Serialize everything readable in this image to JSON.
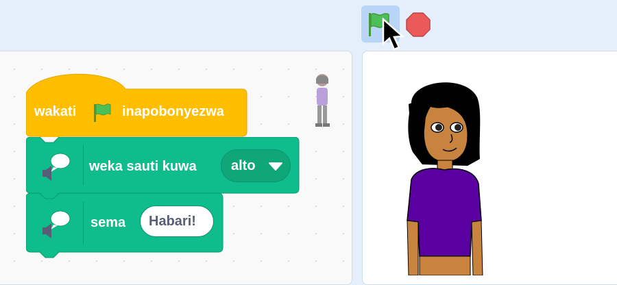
{
  "toolbar": {
    "green_flag_icon": "green-flag-icon",
    "stop_icon": "stop-sign-icon",
    "colors": {
      "flag": "#4cbf56",
      "stop": "#ec5959",
      "flag_button_bg": "#b8d5f8"
    }
  },
  "blocks": {
    "hat": {
      "before": "wakati",
      "after": "inapobonyezwa",
      "color": "#ffbf00"
    },
    "set_voice": {
      "label": "weka sauti kuwa",
      "value": "alto",
      "color": "#0fbd8c"
    },
    "say": {
      "label": "sema",
      "value": "Habari!",
      "color": "#0fbd8c"
    }
  }
}
